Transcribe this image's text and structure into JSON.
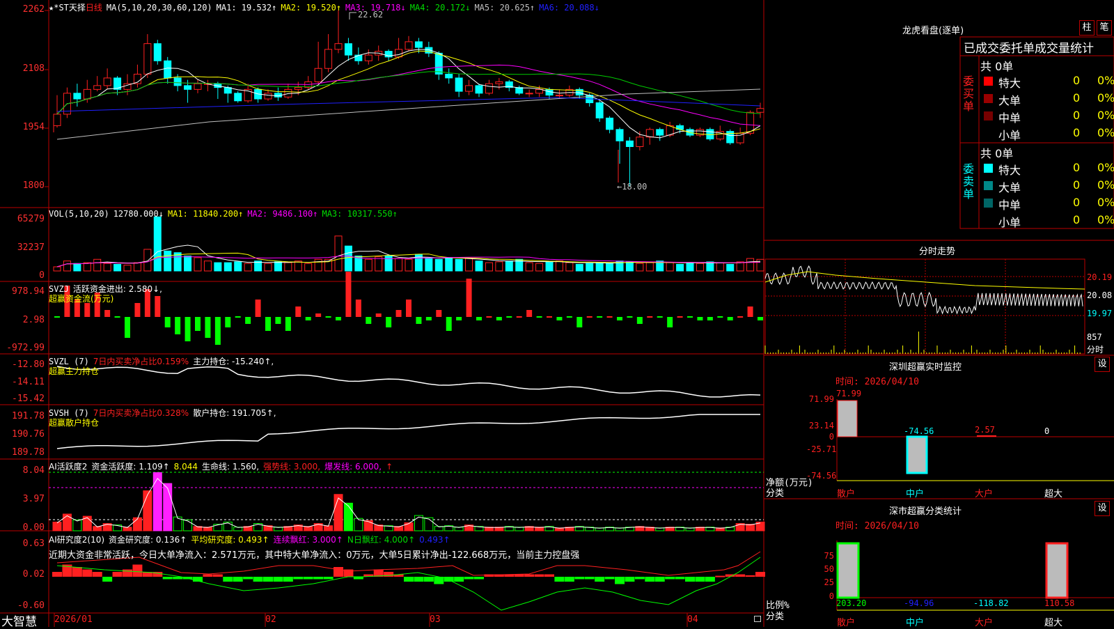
{
  "colors": {
    "up": "#ff2020",
    "down": "#00ffff",
    "ma1": "#ffffff",
    "ma2": "#ffff00",
    "ma3": "#ff00ff",
    "ma4": "#00cc00",
    "ma5": "#c0c0c0",
    "ma6": "#2020ff",
    "grid": "#bb0000",
    "green": "#00ff00"
  },
  "price_panel": {
    "title": "★*ST天择",
    "period": "日线",
    "ma_header": "MA(5,10,20,30,60,120)",
    "ma1": "MA1: 19.532↑",
    "ma2": "MA2: 19.520↑",
    "ma3": "MA3: 19.718↓",
    "ma4": "MA4: 20.172↓",
    "ma5": "MA5: 20.625↑",
    "ma6": "MA6: 20.088↓",
    "high_label": "22.62",
    "low_label": "←18.00",
    "y_ticks": [
      "2262",
      "2108",
      "1954",
      "1800"
    ]
  },
  "vol_panel": {
    "header": "VOL(5,10,20)",
    "vol": "12780.000↓",
    "ma1": "MA1: 11840.200↑",
    "ma2": "MA2: 9486.100↑",
    "ma3": "MA3: 10317.550↑",
    "y_ticks": [
      "65279",
      "32237",
      "0"
    ]
  },
  "svzj_panel": {
    "header": "SVZJ",
    "line1": "活跃资金进出: 2.580↓,",
    "line2": "超赢资金流(万元)",
    "y_ticks": [
      "978.94",
      "2.98",
      "-972.99"
    ]
  },
  "svzl_panel": {
    "header": "SVZL (7)",
    "txt1": "7日内买卖净占比0.159%",
    "txt2": "主力持仓: -15.240↑,",
    "line2": "超赢主力持仓",
    "y_ticks": [
      "-12.80",
      "-14.11",
      "-15.42"
    ]
  },
  "svsh_panel": {
    "header": "SVSH (7)",
    "txt1": "7日内买卖净占比0.328%",
    "txt2": "散户持仓: 191.705↑,",
    "line2": "超赢散户持仓",
    "y_ticks": [
      "191.78",
      "190.76",
      "189.78"
    ]
  },
  "ai1_panel": {
    "header": "AI活跃度2",
    "t1": "资金活跃度: 1.109↑",
    "t2": "8.044",
    "t3": "生命线: 1.560,",
    "t4": "强势线: 3.000,",
    "t5": "爆发线: 6.000,",
    "t6": "↑",
    "y_ticks": [
      "8.04",
      "3.97",
      "0.00"
    ]
  },
  "ai2_panel": {
    "header": "AI研究度2(10)",
    "t1": "资金研究度: 0.136↑",
    "t2": "平均研究度: 0.493↑",
    "t3": "连续飘红: 3.000↑",
    "t4": "N日飘红: 4.000↑",
    "t5": "0.493↑",
    "comment": "近期大资金非常活跃，今日大单净流入：2.571万元，其中特大单净流入：0万元，大单5日累计净出-122.668万元，当前主力控盘强",
    "y_ticks": [
      "0.63",
      "0.02",
      "-0.60"
    ]
  },
  "x_axis": {
    "logo": "大智慧",
    "labels": [
      "2026/01",
      "02",
      "03",
      "04"
    ]
  },
  "right": {
    "lh_title": "龙虎看盘(逐单)",
    "btn_zhu": "柱",
    "btn_bi": "笔",
    "stat_title": "已成交委托单成交量统计",
    "buy_side": "委买单",
    "sell_side": "委卖单",
    "buy_total": "共 0单",
    "sell_total": "共 0单",
    "buy_rows": [
      {
        "name": "特大",
        "val": "0",
        "pct": "0%"
      },
      {
        "name": "大单",
        "val": "0",
        "pct": "0%"
      },
      {
        "name": "中单",
        "val": "0",
        "pct": "0%"
      },
      {
        "name": "小单",
        "val": "0",
        "pct": "0%"
      }
    ],
    "sell_rows": [
      {
        "name": "特大",
        "val": "0",
        "pct": "0%"
      },
      {
        "name": "大单",
        "val": "0",
        "pct": "0%"
      },
      {
        "name": "中单",
        "val": "0",
        "pct": "0%"
      },
      {
        "name": "小单",
        "val": "0",
        "pct": "0%"
      }
    ],
    "buy_colors": [
      "#ff0000",
      "#990000",
      "#770000",
      "#000000"
    ],
    "sell_colors": [
      "#00ffff",
      "#008888",
      "#006666",
      "#000000"
    ],
    "intraday_title": "分时走势",
    "intraday_ticks": [
      "20.19",
      "20.08",
      "19.97",
      "857",
      "分时"
    ],
    "sz_title": "深圳超赢实时监控",
    "sz_set": "设",
    "sz_time": "时间: 2026/04/10",
    "sz_ticks": [
      "71.99",
      "23.14",
      "0",
      "-25.71",
      "-74.56"
    ],
    "sz_vals": [
      "71.99",
      "-74.56",
      "2.57",
      "0"
    ],
    "sz_label": "净额(万元)",
    "sz_label2": "分类",
    "cats": [
      "散户",
      "中户",
      "大户",
      "超大"
    ],
    "cls_title": "深市超赢分类统计",
    "cls_set": "设",
    "cls_time": "时间: 2026/04/10",
    "cls_ticks": [
      "75",
      "50",
      "25",
      "0"
    ],
    "cls_vals": [
      "203.20",
      "-94.96",
      "-118.82",
      "110.58"
    ],
    "cls_label": "比例%",
    "cls_label2": "分类"
  },
  "chart_data": {
    "type": "candlestick",
    "candles": [
      [
        19.6,
        19.9,
        20.4,
        19.55
      ],
      [
        19.9,
        20.45,
        20.6,
        19.8
      ],
      [
        20.45,
        20.3,
        20.7,
        20.1
      ],
      [
        20.3,
        20.55,
        20.8,
        20.2
      ],
      [
        20.55,
        20.65,
        20.9,
        20.5
      ],
      [
        20.65,
        20.85,
        21.1,
        20.55
      ],
      [
        20.85,
        20.55,
        20.9,
        20.4
      ],
      [
        20.55,
        20.7,
        20.95,
        20.4
      ],
      [
        20.7,
        20.95,
        21.2,
        20.6
      ],
      [
        20.95,
        21.75,
        22.0,
        20.85
      ],
      [
        21.75,
        21.3,
        21.85,
        21.2
      ],
      [
        21.3,
        20.85,
        21.4,
        20.7
      ],
      [
        20.85,
        20.65,
        20.95,
        20.5
      ],
      [
        20.65,
        20.55,
        20.8,
        20.2
      ],
      [
        20.55,
        20.7,
        20.8,
        20.45
      ],
      [
        20.7,
        20.7,
        20.8,
        20.5
      ],
      [
        20.7,
        20.6,
        20.75,
        20.3
      ],
      [
        20.6,
        20.45,
        20.65,
        20.2
      ],
      [
        20.45,
        20.25,
        20.5,
        20.2
      ],
      [
        20.25,
        20.55,
        20.7,
        20.2
      ],
      [
        20.55,
        20.3,
        20.6,
        20.2
      ],
      [
        20.3,
        20.45,
        20.55,
        20.25
      ],
      [
        20.45,
        20.35,
        20.6,
        20.25
      ],
      [
        20.35,
        20.55,
        20.7,
        20.3
      ],
      [
        20.55,
        20.6,
        20.75,
        20.4
      ],
      [
        20.6,
        20.75,
        20.9,
        20.55
      ],
      [
        20.75,
        21.1,
        21.8,
        20.7
      ],
      [
        21.1,
        21.6,
        22.0,
        21.0
      ],
      [
        21.6,
        21.75,
        22.62,
        21.5
      ],
      [
        21.75,
        21.45,
        21.9,
        21.3
      ],
      [
        21.45,
        21.3,
        21.65,
        21.2
      ],
      [
        21.3,
        21.45,
        21.6,
        21.2
      ],
      [
        21.45,
        21.55,
        21.7,
        21.3
      ],
      [
        21.55,
        21.4,
        21.6,
        21.3
      ],
      [
        21.4,
        21.6,
        21.9,
        21.35
      ],
      [
        21.6,
        21.8,
        21.95,
        21.55
      ],
      [
        21.8,
        21.65,
        21.9,
        21.5
      ],
      [
        21.65,
        21.5,
        21.8,
        21.4
      ],
      [
        21.5,
        20.95,
        21.55,
        20.8
      ],
      [
        20.95,
        20.85,
        21.1,
        20.7
      ],
      [
        20.85,
        20.5,
        20.95,
        20.35
      ],
      [
        20.5,
        20.65,
        20.8,
        20.4
      ],
      [
        20.65,
        20.45,
        20.7,
        20.35
      ],
      [
        20.45,
        20.7,
        20.8,
        20.4
      ],
      [
        20.7,
        20.75,
        20.85,
        20.55
      ],
      [
        20.75,
        20.6,
        20.8,
        20.5
      ],
      [
        20.6,
        20.45,
        20.65,
        20.4
      ],
      [
        20.45,
        20.45,
        20.55,
        20.35
      ],
      [
        20.45,
        20.55,
        20.65,
        20.35
      ],
      [
        20.55,
        20.4,
        20.6,
        20.3
      ],
      [
        20.4,
        20.4,
        20.55,
        20.3
      ],
      [
        20.4,
        20.55,
        20.65,
        20.35
      ],
      [
        20.55,
        20.4,
        20.6,
        20.3
      ],
      [
        20.4,
        20.2,
        20.45,
        20.1
      ],
      [
        20.2,
        19.8,
        20.25,
        19.7
      ],
      [
        19.8,
        19.5,
        19.85,
        19.4
      ],
      [
        19.5,
        19.2,
        19.55,
        18.6
      ],
      [
        19.2,
        19.05,
        19.3,
        18.0
      ],
      [
        19.05,
        19.3,
        19.45,
        18.95
      ],
      [
        19.3,
        19.5,
        19.55,
        19.1
      ],
      [
        19.5,
        19.35,
        19.55,
        19.2
      ],
      [
        19.35,
        19.6,
        19.7,
        19.3
      ],
      [
        19.6,
        19.5,
        19.65,
        19.4
      ],
      [
        19.5,
        19.35,
        19.55,
        19.3
      ],
      [
        19.35,
        19.5,
        19.55,
        19.3
      ],
      [
        19.5,
        19.25,
        19.55,
        19.2
      ],
      [
        19.25,
        19.45,
        19.6,
        19.2
      ],
      [
        19.45,
        19.15,
        19.5,
        19.1
      ],
      [
        19.15,
        19.4,
        19.55,
        19.1
      ],
      [
        19.4,
        19.95,
        20.0,
        19.35
      ],
      [
        19.95,
        20.05,
        20.2,
        19.8
      ]
    ]
  }
}
